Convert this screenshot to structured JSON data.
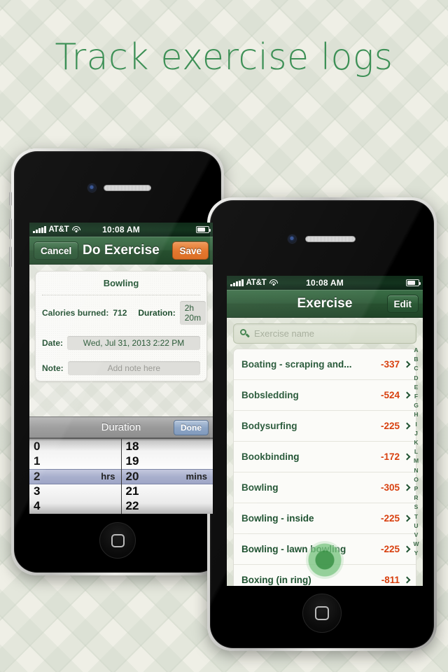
{
  "headline": "Track exercise logs",
  "colors": {
    "headline_green": "#3d9056",
    "nav_green": "#2d5a37",
    "save_orange": "#e4782f",
    "value_red": "#d8400f",
    "label_green": "#1f5231",
    "background": "#efefe6"
  },
  "left_phone": {
    "status_bar": {
      "carrier": "AT&T",
      "time": "10:08 AM"
    },
    "nav": {
      "cancel": "Cancel",
      "title": "Do Exercise",
      "save": "Save"
    },
    "card": {
      "exercise_name": "Bowling",
      "calories_label": "Calories burned:",
      "calories_value": "712",
      "duration_label": "Duration:",
      "duration_value": "2h 20m",
      "date_label": "Date:",
      "date_value": "Wed, Jul 31, 2013 2:22 PM",
      "note_label": "Note:",
      "note_placeholder": "Add note here"
    },
    "picker": {
      "title": "Duration",
      "done": "Done",
      "hours_unit": "hrs",
      "mins_unit": "mins",
      "hours": [
        "0",
        "1",
        "2",
        "3",
        "4"
      ],
      "hours_selected_index": 2,
      "minutes": [
        "18",
        "19",
        "20",
        "21",
        "22"
      ],
      "minutes_selected_index": 2
    }
  },
  "right_phone": {
    "status_bar": {
      "carrier": "AT&T",
      "time": "10:08 AM"
    },
    "nav": {
      "title": "Exercise",
      "edit": "Edit"
    },
    "search": {
      "placeholder": "Exercise name",
      "icon": "search-icon"
    },
    "list": [
      {
        "name": "Boating - scraping and...",
        "value": "-337"
      },
      {
        "name": "Bobsledding",
        "value": "-524"
      },
      {
        "name": "Bodysurfing",
        "value": "-225"
      },
      {
        "name": "Bookbinding",
        "value": "-172"
      },
      {
        "name": "Bowling",
        "value": "-305"
      },
      {
        "name": "Bowling - inside",
        "value": "-225"
      },
      {
        "name": "Bowling - lawn bowling",
        "value": "-225"
      },
      {
        "name": "Boxing (in ring)",
        "value": "-811"
      }
    ],
    "alpha_index": [
      "A",
      "B",
      "C",
      "D",
      "E",
      "F",
      "G",
      "H",
      "I",
      "J",
      "K",
      "L",
      "M",
      "N",
      "O",
      "P",
      "R",
      "S",
      "T",
      "U",
      "V",
      "W",
      "Y"
    ]
  }
}
